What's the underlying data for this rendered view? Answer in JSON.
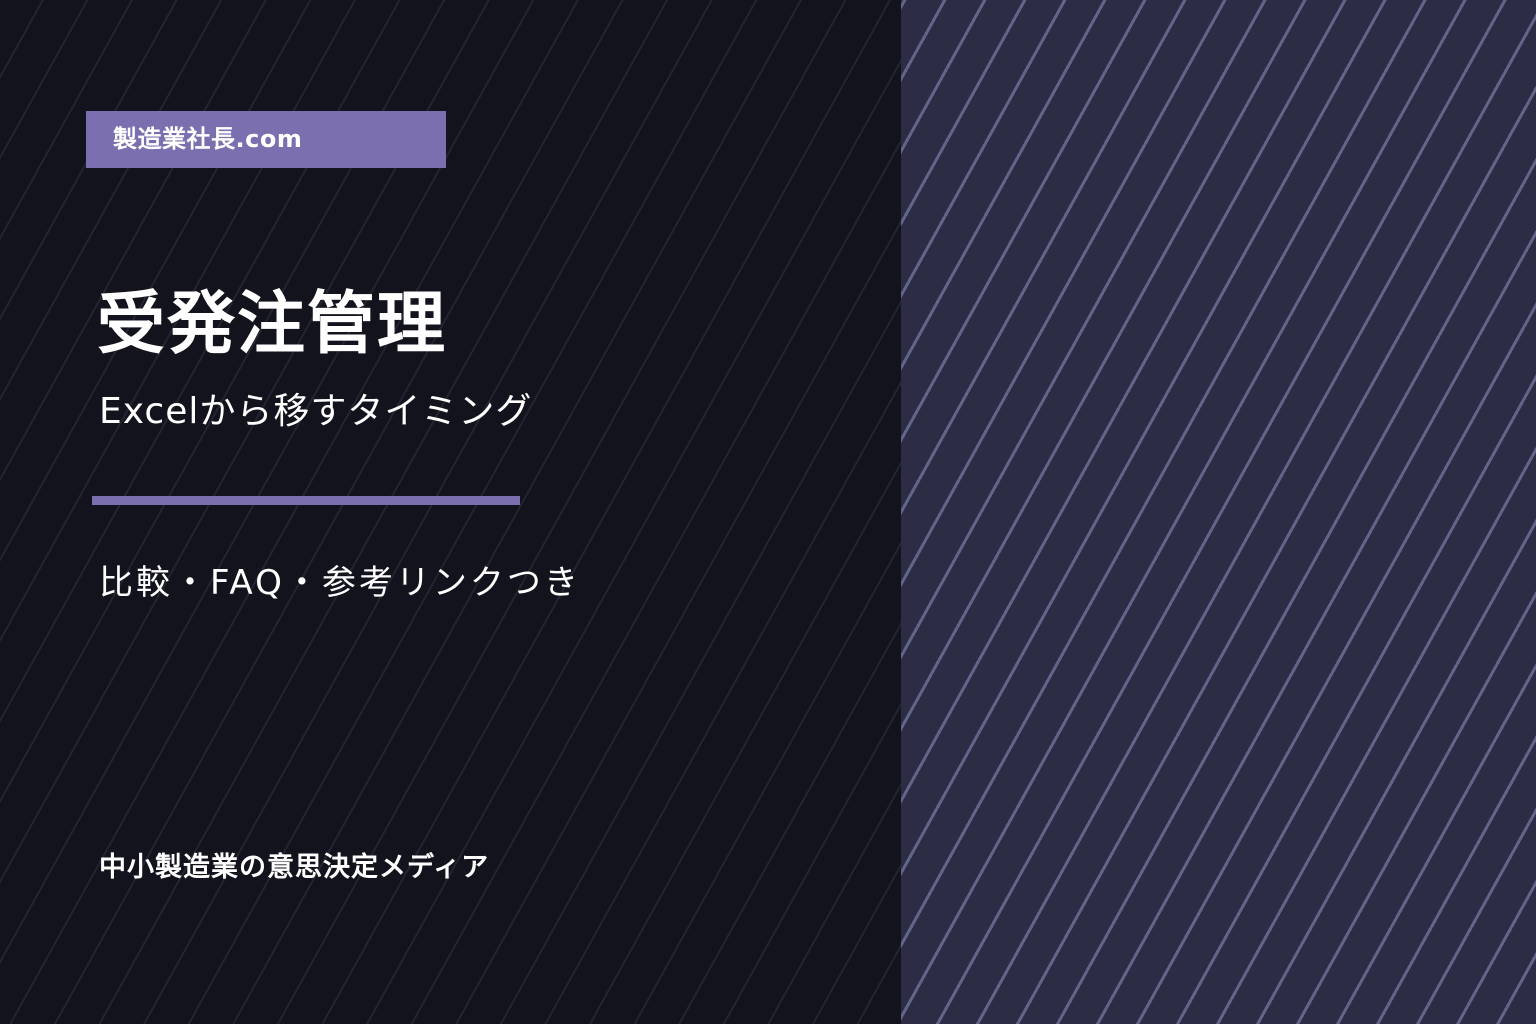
{
  "brand": {
    "label": "製造業社長.com",
    "accent_color": "#7b6fb0"
  },
  "hero": {
    "title": "受発注管理",
    "subtitle": "Excelから移すタイミング",
    "features": "比較・FAQ・参考リンクつき"
  },
  "footer": {
    "tagline": "中小製造業の意思決定メディア"
  },
  "colors": {
    "left_background": "#12131c",
    "right_background": "#2c2d44",
    "stripe_right": "#74789e",
    "text": "#ffffff"
  }
}
